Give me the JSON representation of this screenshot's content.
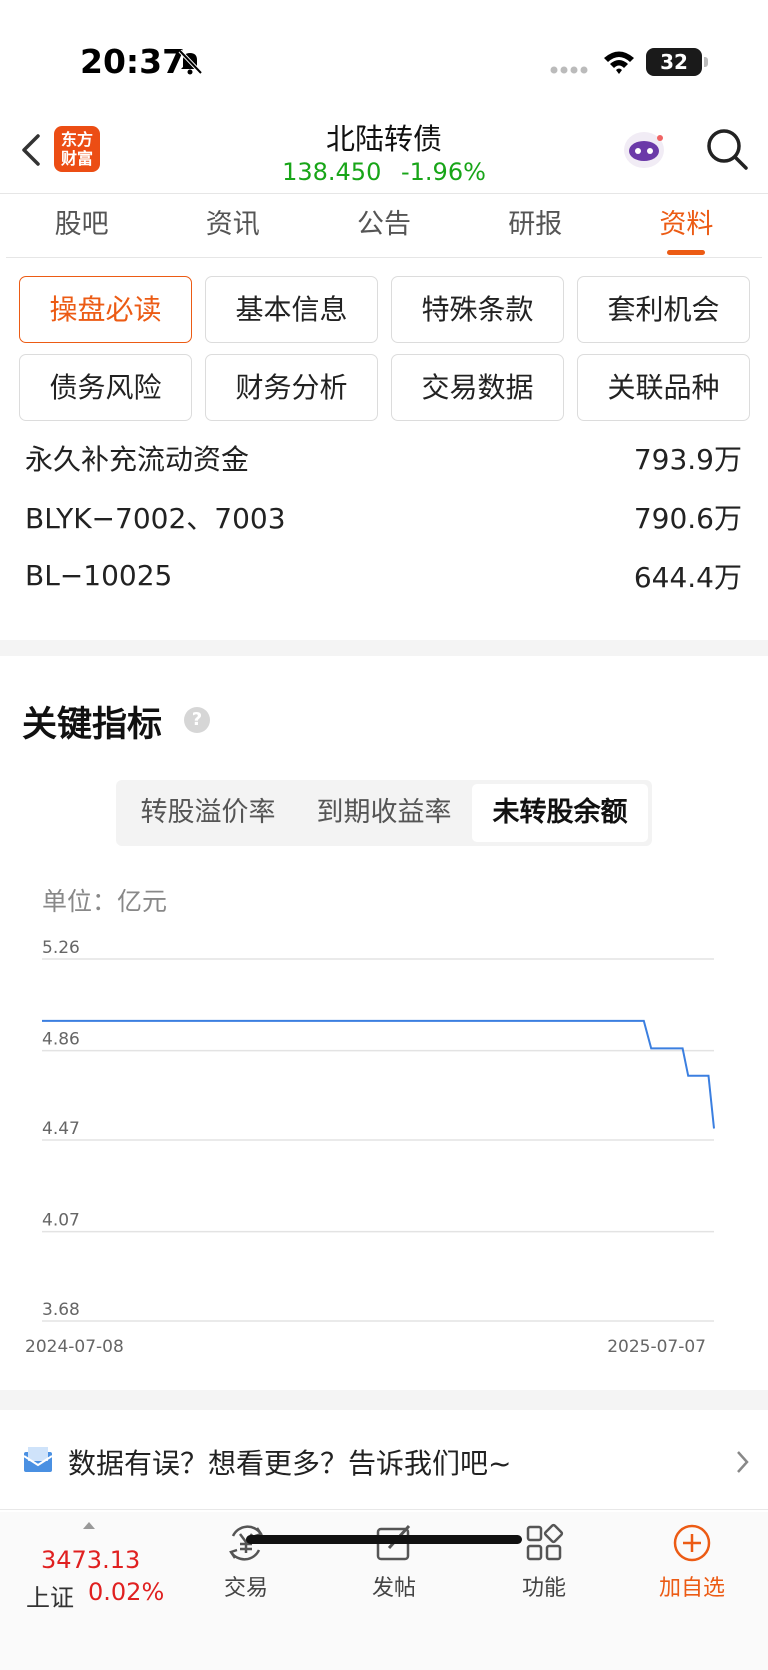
{
  "status_bar": {
    "time": "20:37",
    "battery": "32"
  },
  "header": {
    "logo_text": "东方财富",
    "title": "北陆转债",
    "price": "138.450",
    "change_pct": "-1.96%"
  },
  "tabs": [
    {
      "label": "股吧"
    },
    {
      "label": "资讯"
    },
    {
      "label": "公告"
    },
    {
      "label": "研报"
    },
    {
      "label": "资料",
      "active": true
    }
  ],
  "categories": [
    {
      "label": "操盘必读",
      "active": true
    },
    {
      "label": "基本信息"
    },
    {
      "label": "特殊条款"
    },
    {
      "label": "套利机会"
    },
    {
      "label": "债务风险"
    },
    {
      "label": "财务分析"
    },
    {
      "label": "交易数据"
    },
    {
      "label": "关联品种"
    }
  ],
  "fund_usage": [
    {
      "name": "永久补充流动资金",
      "amount": "793.9万"
    },
    {
      "name": "BLYK−7002、7003",
      "amount": "790.6万"
    },
    {
      "name": "BL−10025",
      "amount": "644.4万"
    }
  ],
  "key_indicators": {
    "title": "关键指标",
    "help_glyph": "?",
    "segments": [
      {
        "label": "转股溢价率"
      },
      {
        "label": "到期收益率"
      },
      {
        "label": "未转股余额",
        "active": true
      }
    ],
    "unit": "单位：亿元"
  },
  "chart_data": {
    "type": "line",
    "ylim": [
      3.68,
      5.26
    ],
    "y_ticks": [
      "5.26",
      "4.86",
      "4.47",
      "4.07",
      "3.68"
    ],
    "x_ticks": [
      "2024-07-08",
      "2025-07-07"
    ],
    "series": [
      {
        "color": "#3b7fe0",
        "points": [
          [
            "2024-07-08",
            4.99
          ],
          [
            "2025-05-30",
            4.99
          ],
          [
            "2025-06-03",
            4.87
          ],
          [
            "2025-06-20",
            4.87
          ],
          [
            "2025-06-23",
            4.75
          ],
          [
            "2025-07-04",
            4.75
          ],
          [
            "2025-07-07",
            4.52
          ]
        ]
      }
    ],
    "grid": true
  },
  "feedback": {
    "text": "数据有误？想看更多？告诉我们吧~"
  },
  "bottom_bar": {
    "index_value": "3473.13",
    "index_name": "上证",
    "index_pct": "0.02%",
    "nav": [
      {
        "label": "交易",
        "icon": "yen-exchange-icon"
      },
      {
        "label": "发帖",
        "icon": "edit-icon"
      },
      {
        "label": "功能",
        "icon": "grid-icon"
      },
      {
        "label": "加自选",
        "icon": "plus-circle-icon"
      }
    ]
  }
}
